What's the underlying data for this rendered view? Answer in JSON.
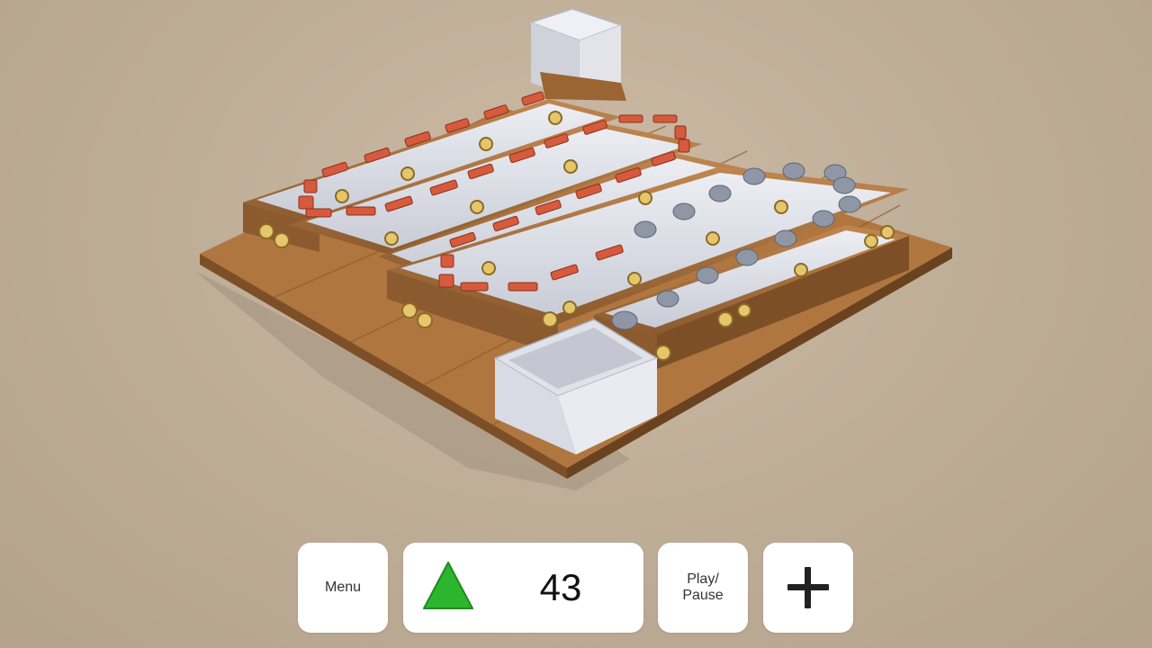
{
  "hud": {
    "menu_label": "Menu",
    "counter_value": "43",
    "counter_icon": "green-triangle-icon",
    "play_pause_label": "Play/ Pause",
    "add_icon": "plus-icon"
  },
  "colors": {
    "background": "#bfae98",
    "wood": "#a8703e",
    "belt": "#dcdde4",
    "triangle": "#2eb52e",
    "brick": "#d65a3c",
    "stone": "#8f96a6"
  }
}
